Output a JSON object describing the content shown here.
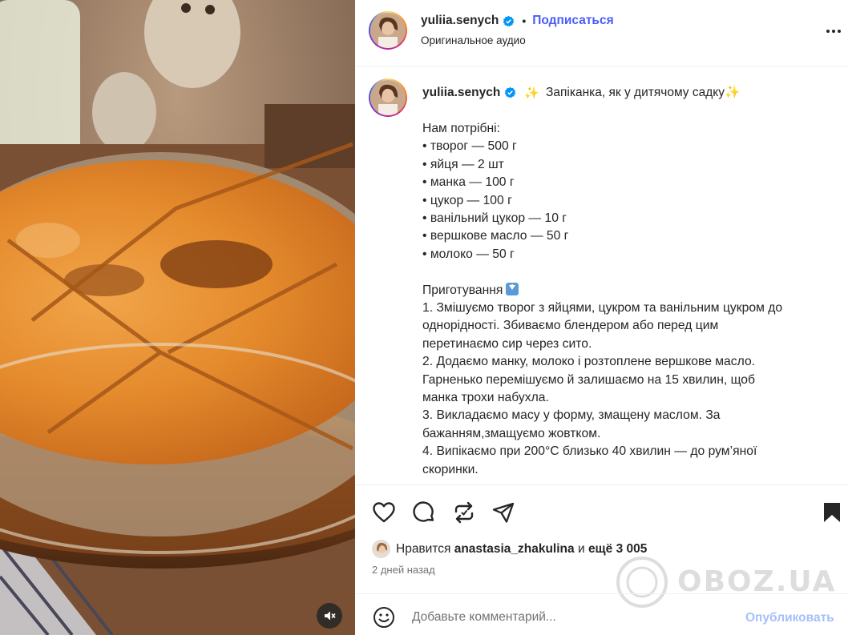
{
  "post": {
    "username": "yuliia.senych",
    "follow_label": "Подписаться",
    "separator": "•",
    "audio_label": "Оригинальное аудио"
  },
  "caption": {
    "username": "yuliia.senych",
    "sparkle_emoji": "✨",
    "title": "Запіканка, як у дитячому садку✨",
    "lines_ingredients": [
      "Нам потрібні:",
      "• творог — 500 г",
      "• яйця — 2 шт",
      "• манка — 100 г",
      "• цукор — 100 г",
      "• ванільний цукор — 10 г",
      "• вершкове масло — 50 г",
      "• молоко — 50 г"
    ],
    "preparation_heading": "Приготування",
    "lines_steps": [
      "1. Змішуємо творог з яйцями, цукром та ванільним цукром до",
      "однорідності. Збиваємо блендером або перед цим",
      "перетинаємо сир через сито.",
      "2. Додаємо манку, молоко і розтоплене вершкове масло.",
      "Гарненько перемішуємо й залишаємо на 15 хвилин, щоб",
      "манка трохи набухла.",
      "3. Викладаємо масу у форму, змащену маслом. За",
      "бажанням,змащуємо жовтком.",
      "4. Випікаємо при 200°С близько 40 хвилин — до рум’яної",
      "скоринки."
    ]
  },
  "likes": {
    "prefix": "Нравится",
    "user": "anastasia_zhakulina",
    "middle": "и",
    "count_text": "ещё 3 005"
  },
  "date_label": "2 дней назад",
  "comment": {
    "placeholder": "Добавьте комментарий...",
    "publish_label": "Опубликовать"
  },
  "watermark_text": "OBOZ.UA",
  "icons": {
    "verified": "verified-badge-icon",
    "more": "more-options-icon",
    "like": "heart-icon",
    "comment": "comment-icon",
    "repost": "repost-icon",
    "share": "share-icon",
    "save": "bookmark-icon",
    "emoji": "emoji-icon",
    "mute": "speaker-muted-icon"
  },
  "colors": {
    "accent": "#4a5df9",
    "publish_disabled": "#a6bffb",
    "text_secondary": "#737373",
    "verified": "#0095f6"
  }
}
